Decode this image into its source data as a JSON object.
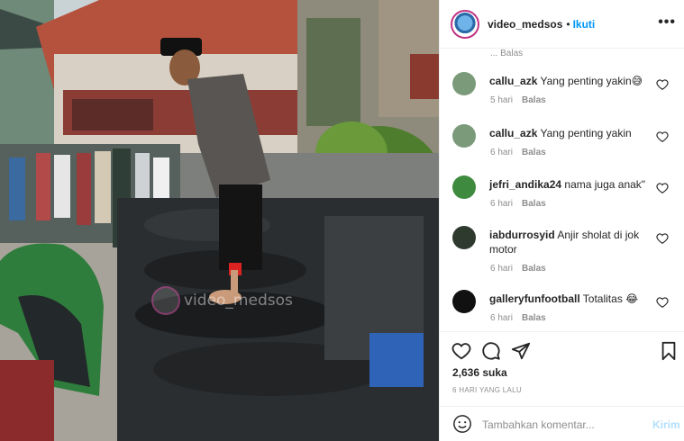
{
  "post": {
    "username": "video_medsos",
    "separator": "•",
    "follow_label": "Ikuti",
    "more_icon": "more-horizontal-icon",
    "watermark": "video_medsos",
    "likes": "2,636 suka",
    "date": "6 HARI YANG LALU"
  },
  "comments_header": {
    "partial_meta": "... Balas"
  },
  "comments": [
    {
      "username": "callu_azk",
      "text": "Yang penting yakin😅",
      "age": "5 hari",
      "reply": "Balas",
      "avatar_color": "#7a9a7a"
    },
    {
      "username": "callu_azk",
      "text": "Yang penting yakin",
      "age": "6 hari",
      "reply": "Balas",
      "avatar_color": "#7a9a7a"
    },
    {
      "username": "jefri_andika24",
      "text": "nama juga anak\"",
      "age": "6 hari",
      "reply": "Balas",
      "avatar_color": "#3e8a3e"
    },
    {
      "username": "iabdurrosyid",
      "text": "Anjir sholat di jok motor",
      "age": "6 hari",
      "reply": "Balas",
      "avatar_color": "#2f3a2f"
    },
    {
      "username": "galleryfunfootball",
      "text": "Totalitas 😂",
      "age": "6 hari",
      "reply": "Balas",
      "avatar_color": "#111111"
    }
  ],
  "composer": {
    "placeholder": "Tambahkan komentar...",
    "send_label": "Kirim"
  },
  "colors": {
    "accent": "#0095f6",
    "muted": "#8e8e8e",
    "send_disabled": "#b2dffc"
  }
}
